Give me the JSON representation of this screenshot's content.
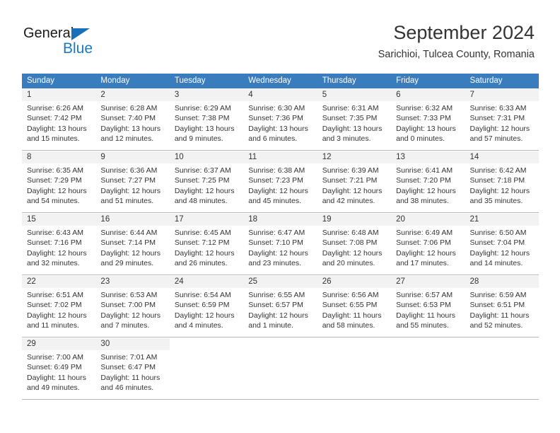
{
  "brand": {
    "name_dark": "General",
    "name_blue": "Blue",
    "accent_color": "#1a7ac4",
    "triangle_color": "#1a70b8"
  },
  "header": {
    "title": "September 2024",
    "subtitle": "Sarichioi, Tulcea County, Romania"
  },
  "calendar": {
    "header_bg": "#3a7dbf",
    "header_text_color": "#ffffff",
    "daynum_band_color": "#f2f2f2",
    "weekdays": [
      "Sunday",
      "Monday",
      "Tuesday",
      "Wednesday",
      "Thursday",
      "Friday",
      "Saturday"
    ],
    "weeks": [
      [
        {
          "day": "1",
          "sunrise": "Sunrise: 6:26 AM",
          "sunset": "Sunset: 7:42 PM",
          "daylight1": "Daylight: 13 hours",
          "daylight2": "and 15 minutes."
        },
        {
          "day": "2",
          "sunrise": "Sunrise: 6:28 AM",
          "sunset": "Sunset: 7:40 PM",
          "daylight1": "Daylight: 13 hours",
          "daylight2": "and 12 minutes."
        },
        {
          "day": "3",
          "sunrise": "Sunrise: 6:29 AM",
          "sunset": "Sunset: 7:38 PM",
          "daylight1": "Daylight: 13 hours",
          "daylight2": "and 9 minutes."
        },
        {
          "day": "4",
          "sunrise": "Sunrise: 6:30 AM",
          "sunset": "Sunset: 7:36 PM",
          "daylight1": "Daylight: 13 hours",
          "daylight2": "and 6 minutes."
        },
        {
          "day": "5",
          "sunrise": "Sunrise: 6:31 AM",
          "sunset": "Sunset: 7:35 PM",
          "daylight1": "Daylight: 13 hours",
          "daylight2": "and 3 minutes."
        },
        {
          "day": "6",
          "sunrise": "Sunrise: 6:32 AM",
          "sunset": "Sunset: 7:33 PM",
          "daylight1": "Daylight: 13 hours",
          "daylight2": "and 0 minutes."
        },
        {
          "day": "7",
          "sunrise": "Sunrise: 6:33 AM",
          "sunset": "Sunset: 7:31 PM",
          "daylight1": "Daylight: 12 hours",
          "daylight2": "and 57 minutes."
        }
      ],
      [
        {
          "day": "8",
          "sunrise": "Sunrise: 6:35 AM",
          "sunset": "Sunset: 7:29 PM",
          "daylight1": "Daylight: 12 hours",
          "daylight2": "and 54 minutes."
        },
        {
          "day": "9",
          "sunrise": "Sunrise: 6:36 AM",
          "sunset": "Sunset: 7:27 PM",
          "daylight1": "Daylight: 12 hours",
          "daylight2": "and 51 minutes."
        },
        {
          "day": "10",
          "sunrise": "Sunrise: 6:37 AM",
          "sunset": "Sunset: 7:25 PM",
          "daylight1": "Daylight: 12 hours",
          "daylight2": "and 48 minutes."
        },
        {
          "day": "11",
          "sunrise": "Sunrise: 6:38 AM",
          "sunset": "Sunset: 7:23 PM",
          "daylight1": "Daylight: 12 hours",
          "daylight2": "and 45 minutes."
        },
        {
          "day": "12",
          "sunrise": "Sunrise: 6:39 AM",
          "sunset": "Sunset: 7:21 PM",
          "daylight1": "Daylight: 12 hours",
          "daylight2": "and 42 minutes."
        },
        {
          "day": "13",
          "sunrise": "Sunrise: 6:41 AM",
          "sunset": "Sunset: 7:20 PM",
          "daylight1": "Daylight: 12 hours",
          "daylight2": "and 38 minutes."
        },
        {
          "day": "14",
          "sunrise": "Sunrise: 6:42 AM",
          "sunset": "Sunset: 7:18 PM",
          "daylight1": "Daylight: 12 hours",
          "daylight2": "and 35 minutes."
        }
      ],
      [
        {
          "day": "15",
          "sunrise": "Sunrise: 6:43 AM",
          "sunset": "Sunset: 7:16 PM",
          "daylight1": "Daylight: 12 hours",
          "daylight2": "and 32 minutes."
        },
        {
          "day": "16",
          "sunrise": "Sunrise: 6:44 AM",
          "sunset": "Sunset: 7:14 PM",
          "daylight1": "Daylight: 12 hours",
          "daylight2": "and 29 minutes."
        },
        {
          "day": "17",
          "sunrise": "Sunrise: 6:45 AM",
          "sunset": "Sunset: 7:12 PM",
          "daylight1": "Daylight: 12 hours",
          "daylight2": "and 26 minutes."
        },
        {
          "day": "18",
          "sunrise": "Sunrise: 6:47 AM",
          "sunset": "Sunset: 7:10 PM",
          "daylight1": "Daylight: 12 hours",
          "daylight2": "and 23 minutes."
        },
        {
          "day": "19",
          "sunrise": "Sunrise: 6:48 AM",
          "sunset": "Sunset: 7:08 PM",
          "daylight1": "Daylight: 12 hours",
          "daylight2": "and 20 minutes."
        },
        {
          "day": "20",
          "sunrise": "Sunrise: 6:49 AM",
          "sunset": "Sunset: 7:06 PM",
          "daylight1": "Daylight: 12 hours",
          "daylight2": "and 17 minutes."
        },
        {
          "day": "21",
          "sunrise": "Sunrise: 6:50 AM",
          "sunset": "Sunset: 7:04 PM",
          "daylight1": "Daylight: 12 hours",
          "daylight2": "and 14 minutes."
        }
      ],
      [
        {
          "day": "22",
          "sunrise": "Sunrise: 6:51 AM",
          "sunset": "Sunset: 7:02 PM",
          "daylight1": "Daylight: 12 hours",
          "daylight2": "and 11 minutes."
        },
        {
          "day": "23",
          "sunrise": "Sunrise: 6:53 AM",
          "sunset": "Sunset: 7:00 PM",
          "daylight1": "Daylight: 12 hours",
          "daylight2": "and 7 minutes."
        },
        {
          "day": "24",
          "sunrise": "Sunrise: 6:54 AM",
          "sunset": "Sunset: 6:59 PM",
          "daylight1": "Daylight: 12 hours",
          "daylight2": "and 4 minutes."
        },
        {
          "day": "25",
          "sunrise": "Sunrise: 6:55 AM",
          "sunset": "Sunset: 6:57 PM",
          "daylight1": "Daylight: 12 hours",
          "daylight2": "and 1 minute."
        },
        {
          "day": "26",
          "sunrise": "Sunrise: 6:56 AM",
          "sunset": "Sunset: 6:55 PM",
          "daylight1": "Daylight: 11 hours",
          "daylight2": "and 58 minutes."
        },
        {
          "day": "27",
          "sunrise": "Sunrise: 6:57 AM",
          "sunset": "Sunset: 6:53 PM",
          "daylight1": "Daylight: 11 hours",
          "daylight2": "and 55 minutes."
        },
        {
          "day": "28",
          "sunrise": "Sunrise: 6:59 AM",
          "sunset": "Sunset: 6:51 PM",
          "daylight1": "Daylight: 11 hours",
          "daylight2": "and 52 minutes."
        }
      ],
      [
        {
          "day": "29",
          "sunrise": "Sunrise: 7:00 AM",
          "sunset": "Sunset: 6:49 PM",
          "daylight1": "Daylight: 11 hours",
          "daylight2": "and 49 minutes."
        },
        {
          "day": "30",
          "sunrise": "Sunrise: 7:01 AM",
          "sunset": "Sunset: 6:47 PM",
          "daylight1": "Daylight: 11 hours",
          "daylight2": "and 46 minutes."
        },
        {
          "day": "",
          "sunrise": "",
          "sunset": "",
          "daylight1": "",
          "daylight2": ""
        },
        {
          "day": "",
          "sunrise": "",
          "sunset": "",
          "daylight1": "",
          "daylight2": ""
        },
        {
          "day": "",
          "sunrise": "",
          "sunset": "",
          "daylight1": "",
          "daylight2": ""
        },
        {
          "day": "",
          "sunrise": "",
          "sunset": "",
          "daylight1": "",
          "daylight2": ""
        },
        {
          "day": "",
          "sunrise": "",
          "sunset": "",
          "daylight1": "",
          "daylight2": ""
        }
      ]
    ]
  }
}
